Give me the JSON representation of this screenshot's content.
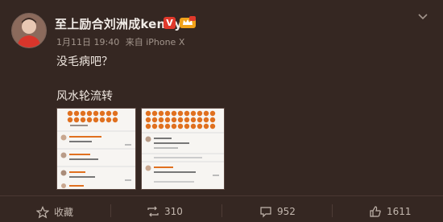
{
  "post": {
    "author": "至上励合刘洲成kenny",
    "badges": [
      "v-badge",
      "crown-badge"
    ],
    "time": "1月11日 19:40",
    "source": "来自 iPhone X",
    "text_lines": [
      "没毛病吧？",
      "风水轮流转"
    ],
    "images": [
      "screenshot-comments-1",
      "screenshot-comments-2"
    ]
  },
  "actions": {
    "favorite_label": "收藏",
    "repost_count": "310",
    "comment_count": "952",
    "like_count": "1611"
  },
  "icons": {
    "more": "chevron-down-icon",
    "favorite": "star-icon",
    "repost": "repost-icon",
    "comment": "comment-icon",
    "like": "thumbs-up-icon"
  },
  "colors": {
    "background": "#352722",
    "verified_badge": "#e0392b",
    "text_primary": "#eee6df",
    "text_secondary": "#a2958c"
  }
}
